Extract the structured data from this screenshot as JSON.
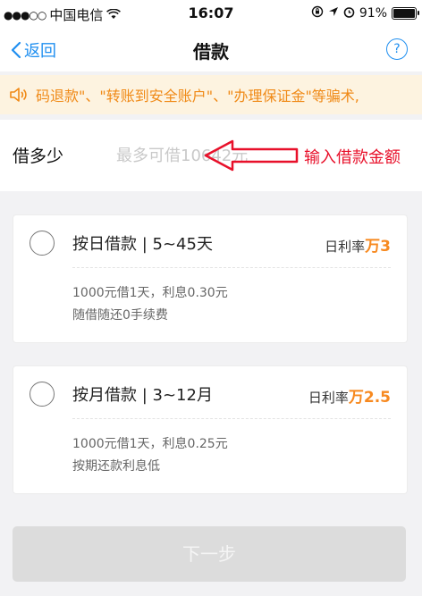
{
  "status_bar": {
    "signal": "●●●○○",
    "carrier": "中国电信",
    "time": "16:07",
    "battery_percent": "91%",
    "battery_level": 0.91
  },
  "navbar": {
    "back_label": "返回",
    "title": "借款",
    "help_label": "?"
  },
  "notice": {
    "text": "码退款\"、\"转账到安全账户\"、\"办理保证金\"等骗术,"
  },
  "amount": {
    "label": "借多少",
    "placeholder": "最多可借10642元",
    "annotation": "输入借款金额"
  },
  "options": [
    {
      "title": "按日借款 | 5~45天",
      "rate_label": "日利率",
      "rate_value": "万3",
      "desc1": "1000元借1天，利息0.30元",
      "desc2": "随借随还0手续费"
    },
    {
      "title": "按月借款 | 3~12月",
      "rate_label": "日利率",
      "rate_value": "万2.5",
      "desc1": "1000元借1天，利息0.25元",
      "desc2": "按期还款利息低"
    }
  ],
  "next_button": {
    "label": "下一步"
  },
  "colors": {
    "accent": "#1f8ff0",
    "orange": "#f7891f",
    "annotation_red": "#e8102a"
  }
}
